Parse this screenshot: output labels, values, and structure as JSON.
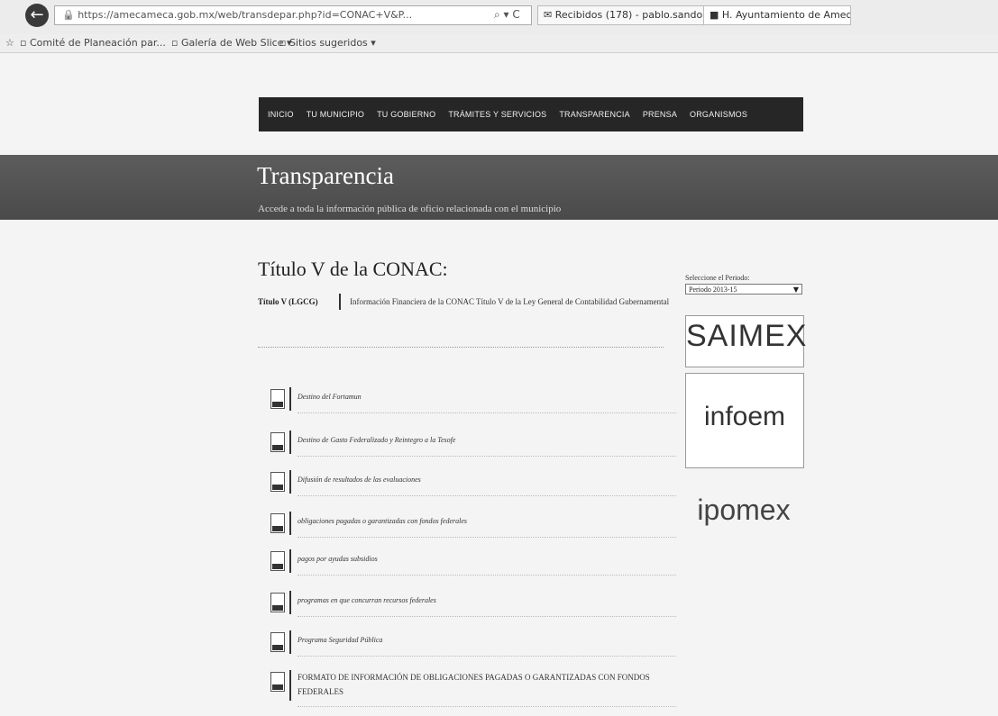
{
  "browser": {
    "url": "https://amecameca.gob.mx/web/transdepar.php?id=CONAC+V&P...",
    "tabs": [
      "Recibidos (178) - pablo.sando...",
      "H. Ayuntamiento de Ameca..."
    ],
    "favorites": [
      "Comité de Planeación par...",
      "Galería de Web Slice ▾",
      "Sitios sugeridos ▾"
    ],
    "controls": "⌕ ▾ C"
  },
  "nav": {
    "items": [
      "INICIO",
      "TU MUNICIPIO",
      "TU GOBIERNO",
      "TRÁMITES Y SERVICIOS",
      "TRANSPARENCIA",
      "PRENSA",
      "ORGANISMOS"
    ]
  },
  "hero": {
    "title": "Transparencia",
    "subtitle": "Accede a toda la información pública de oficio relacionada con el municipio"
  },
  "main": {
    "page_title": "Título V de la CONAC:",
    "section_label": "Título V (LGCG)",
    "section_desc": "Información Financiera de la CONAC Título V de la Ley General de Contabilidad Gubernamental",
    "documents": [
      "Destino del Fortamun",
      "Destino de Gasto Federalizado y Reintegro a la Tesofe",
      "Difusión de resultados de las evaluaciones",
      "obligaciones pagadas o garantizadas con fondos federales",
      "pagos por ayudas subsidios",
      "programas en que concurran recursos federales",
      "Programa Seguridad Pública",
      "FORMATO DE INFORMACIÓN DE OBLIGACIONES PAGADAS O GARANTIZADAS CON FONDOS FEDERALES"
    ]
  },
  "sidebar": {
    "period_label": "Seleccione el Periodo:",
    "period_value": "Periodo 2013-15",
    "logos": {
      "saimex": "SAIMEX",
      "infoem": "infoem",
      "ipomex": "ipomex"
    }
  }
}
